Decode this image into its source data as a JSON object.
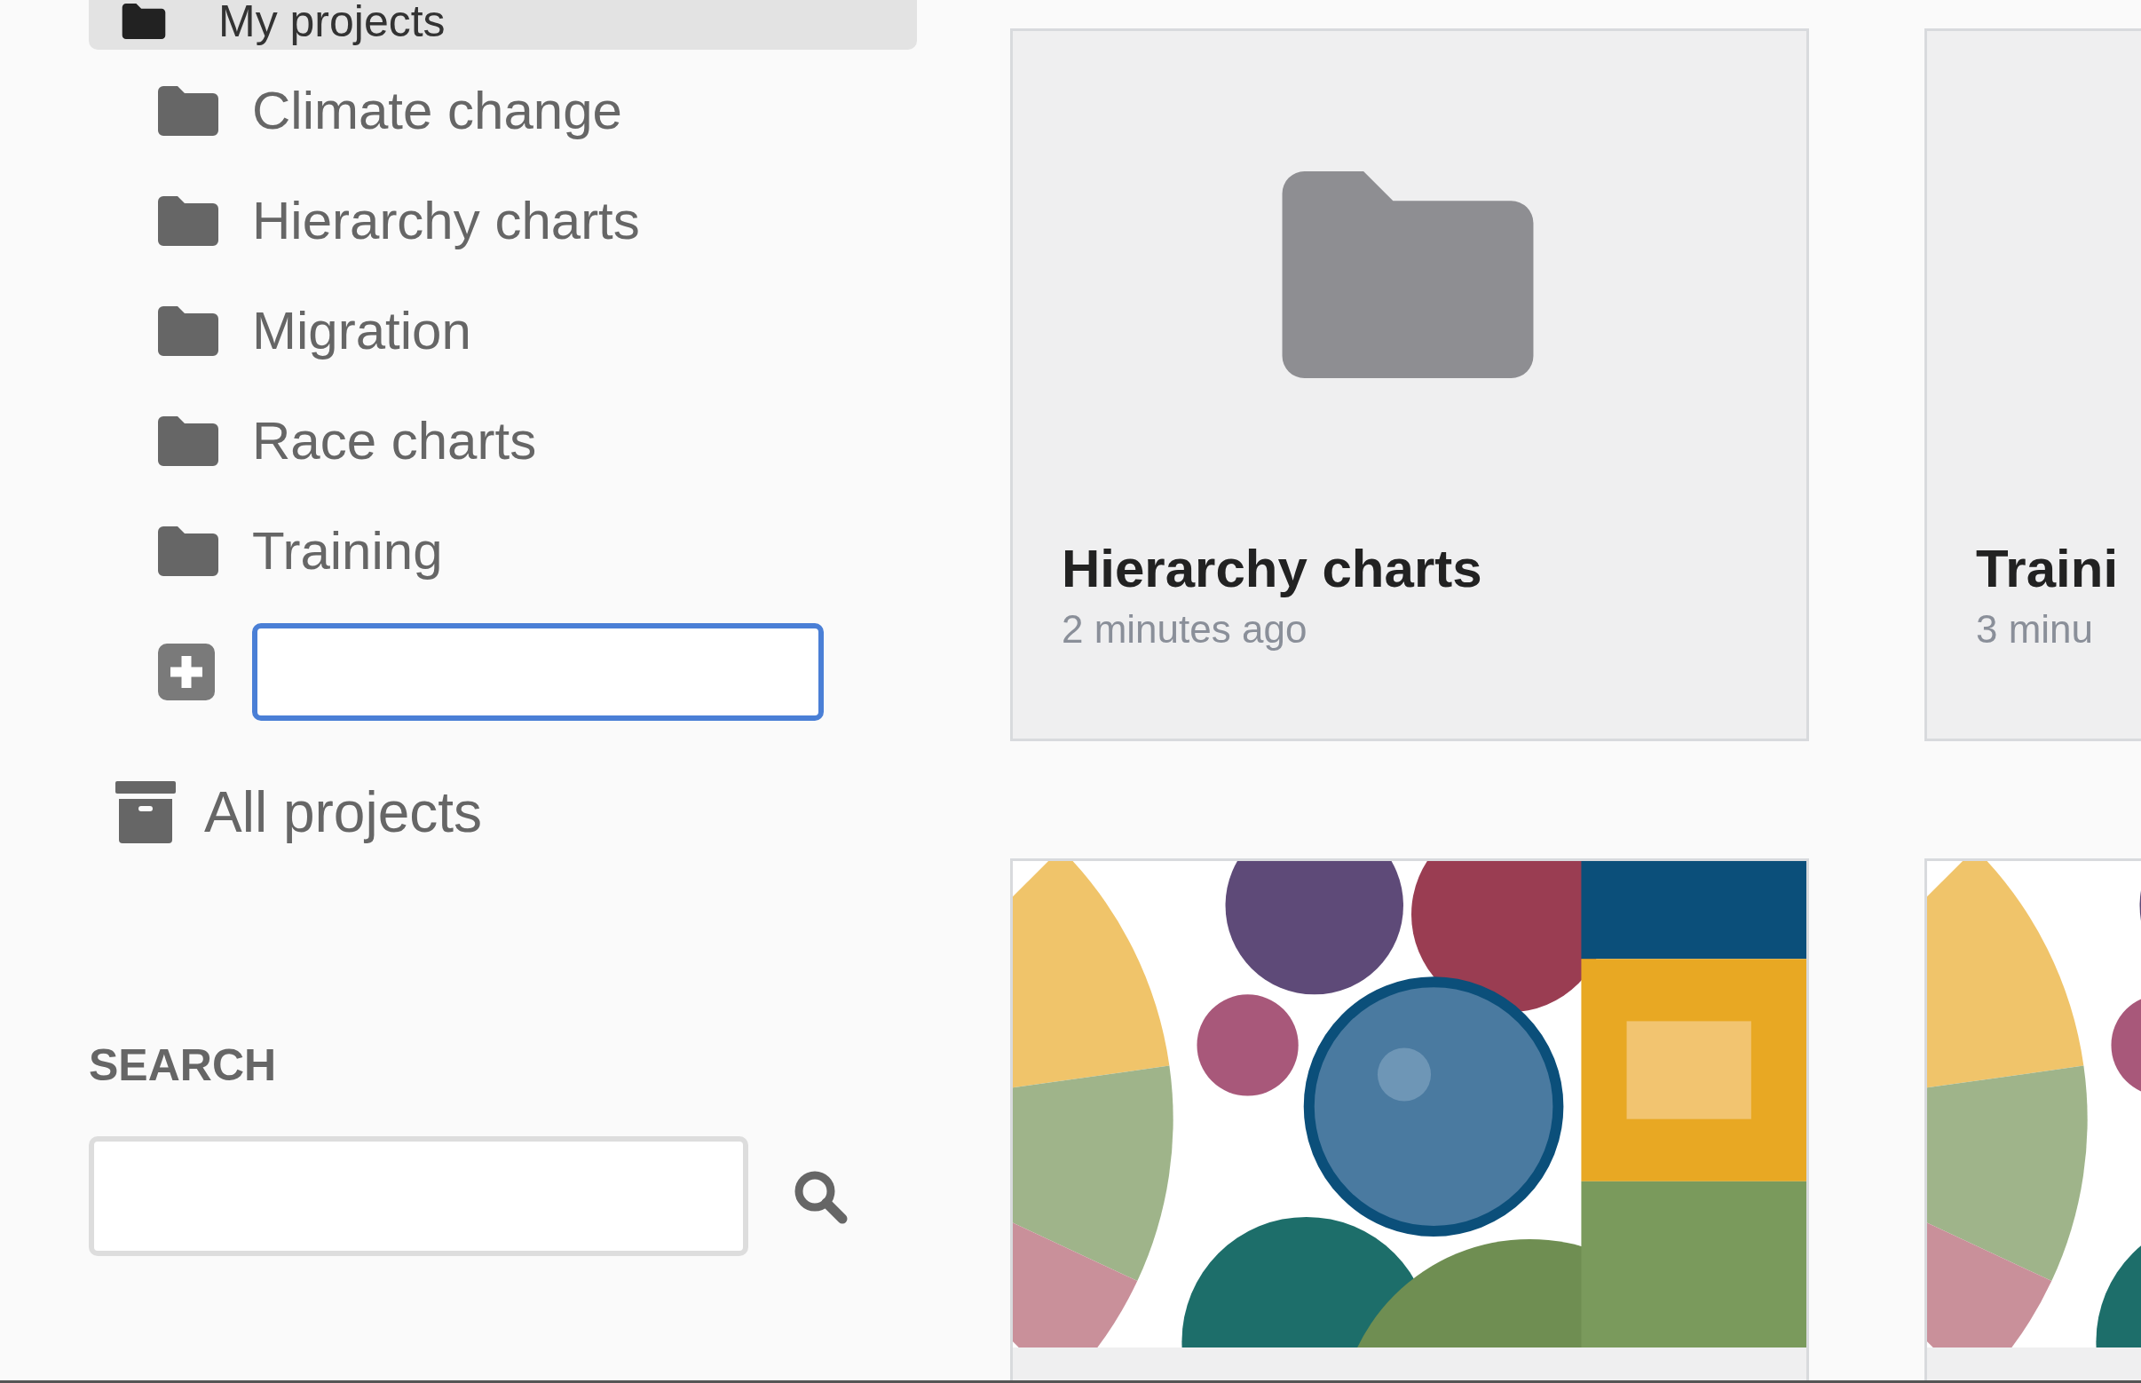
{
  "sidebar": {
    "header": {
      "label": "My projects",
      "selected": true
    },
    "folders": [
      {
        "label": "Climate change"
      },
      {
        "label": "Hierarchy charts"
      },
      {
        "label": "Migration"
      },
      {
        "label": "Race charts"
      },
      {
        "label": "Training"
      }
    ],
    "new_folder_field": {
      "focused": true
    },
    "all_projects": {
      "label": "All projects"
    },
    "search": {
      "label": "SEARCH"
    }
  },
  "cards": [
    {
      "kind": "folder",
      "title": "Hierarchy charts",
      "time": "2 minutes ago"
    },
    {
      "kind": "folder_partial",
      "title": "Traini",
      "time": "3 minu"
    },
    {
      "kind": "picture"
    },
    {
      "kind": "picture"
    }
  ]
}
